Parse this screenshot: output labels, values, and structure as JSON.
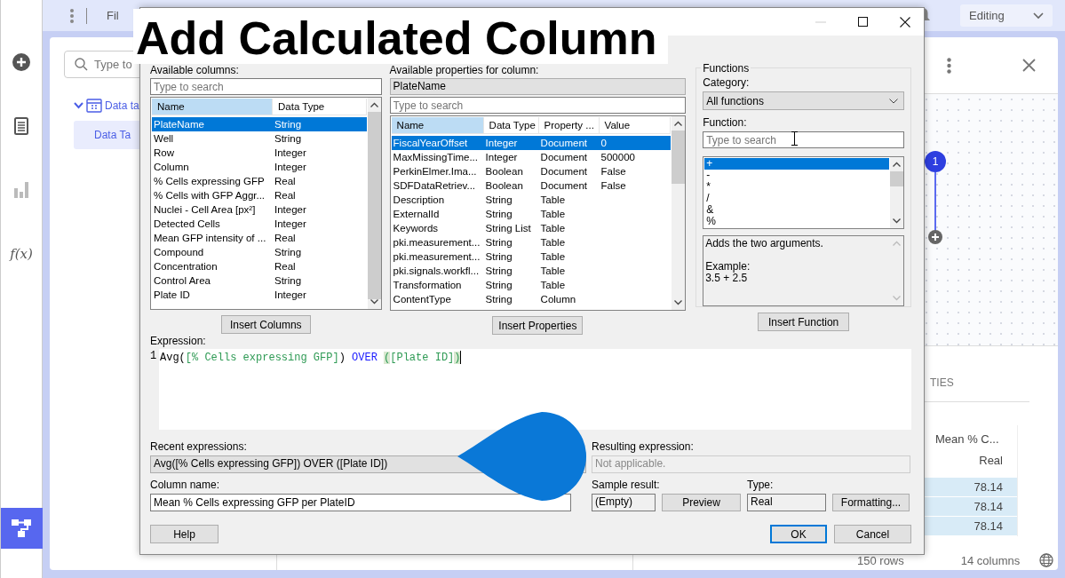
{
  "app": {
    "top_bar": {
      "menu_text": "Fil",
      "mode": "Editing"
    },
    "sidebar": [
      {
        "kind": "add",
        "selected": false,
        "disabled": false
      },
      {
        "kind": "table",
        "selected": false,
        "disabled": false
      },
      {
        "kind": "chart",
        "selected": false,
        "disabled": true
      },
      {
        "kind": "formula",
        "label": "f(x)",
        "selected": false,
        "disabled": false
      },
      {
        "kind": "flow",
        "selected": true,
        "disabled": false
      }
    ],
    "search": {
      "placeholder": "Type to"
    },
    "tree": [
      {
        "label": "Data ta",
        "expanded": true,
        "children": [
          {
            "label": "Data Ta",
            "selected": true
          }
        ]
      }
    ],
    "flow": {
      "step_number": "1"
    },
    "section_heading": "TIES",
    "table": {
      "column": "Mean % C...",
      "type": "Real",
      "values": [
        "78.14",
        "78.14",
        "78.14"
      ]
    },
    "status": {
      "rows": "150 rows",
      "columns": "14 columns"
    }
  },
  "caption": "Add Calculated Column",
  "dialog": {
    "available_columns": {
      "label": "Available columns:",
      "placeholder": "Type to search",
      "columns": [
        "Name",
        "Data Type"
      ],
      "rows": [
        {
          "name": "PlateName",
          "type": "String",
          "selected": true
        },
        {
          "name": "Well",
          "type": "String",
          "selected": false
        },
        {
          "name": "Row",
          "type": "Integer",
          "selected": false
        },
        {
          "name": "Column",
          "type": "Integer",
          "selected": false
        },
        {
          "name": "% Cells expressing GFP",
          "type": "Real",
          "selected": false
        },
        {
          "name": "% Cells with GFP Aggr...",
          "type": "Real",
          "selected": false
        },
        {
          "name": "Nuclei - Cell Area [px²]",
          "type": "Integer",
          "selected": false
        },
        {
          "name": "Detected Cells",
          "type": "Integer",
          "selected": false
        },
        {
          "name": "Mean GFP intensity of ...",
          "type": "Real",
          "selected": false
        },
        {
          "name": "Compound",
          "type": "String",
          "selected": false
        },
        {
          "name": "Concentration",
          "type": "Real",
          "selected": false
        },
        {
          "name": "Control Area",
          "type": "String",
          "selected": false
        },
        {
          "name": "Plate ID",
          "type": "Integer",
          "selected": false
        }
      ],
      "button": "Insert Columns"
    },
    "available_properties": {
      "label": "Available properties for column:",
      "column": "PlateName",
      "placeholder": "Type to search",
      "columns": [
        "Name",
        "Data Type",
        "Property ...",
        "Value"
      ],
      "rows": [
        {
          "name": "FiscalYearOffset",
          "type": "Integer",
          "property": "Document",
          "value": "0",
          "selected": true
        },
        {
          "name": "MaxMissingTime...",
          "type": "Integer",
          "property": "Document",
          "value": "500000",
          "selected": false
        },
        {
          "name": "PerkinElmer.Ima...",
          "type": "Boolean",
          "property": "Document",
          "value": "False",
          "selected": false
        },
        {
          "name": "SDFDataRetriev...",
          "type": "Boolean",
          "property": "Document",
          "value": "False",
          "selected": false
        },
        {
          "name": "Description",
          "type": "String",
          "property": "Table",
          "selected": false
        },
        {
          "name": "ExternalId",
          "type": "String",
          "property": "Table",
          "selected": false
        },
        {
          "name": "Keywords",
          "type": "String List",
          "property": "Table",
          "selected": false
        },
        {
          "name": "pki.measurement...",
          "type": "String",
          "property": "Table",
          "selected": false
        },
        {
          "name": "pki.measurement...",
          "type": "String",
          "property": "Table",
          "selected": false
        },
        {
          "name": "pki.signals.workfl...",
          "type": "String",
          "property": "Table",
          "selected": false
        },
        {
          "name": "Transformation",
          "type": "String",
          "property": "Table",
          "selected": false
        },
        {
          "name": "ContentType",
          "type": "String",
          "property": "Column",
          "selected": false
        }
      ],
      "button": "Insert Properties"
    },
    "functions": {
      "title": "Functions",
      "category_label": "Category:",
      "category": "All functions",
      "function_label": "Function:",
      "placeholder": "Type to search",
      "items": [
        {
          "label": "+",
          "selected": true
        },
        {
          "label": "-",
          "selected": false
        },
        {
          "label": "*",
          "selected": false
        },
        {
          "label": "/",
          "selected": false
        },
        {
          "label": "&",
          "selected": false
        },
        {
          "label": "%",
          "selected": false
        }
      ],
      "description": {
        "text": "Adds the two arguments.",
        "example_label": "Example:",
        "example": "3.5 + 2.5"
      },
      "button": "Insert Function"
    },
    "expression": {
      "label": "Expression:",
      "line_number": "1",
      "tokens": [
        {
          "text": "Avg(",
          "kind": "plain"
        },
        {
          "text": "[% Cells expressing GFP]",
          "kind": "column"
        },
        {
          "text": ") ",
          "kind": "plain"
        },
        {
          "text": "OVER ",
          "kind": "keyword"
        },
        {
          "text": "(",
          "kind": "match"
        },
        {
          "text": "[Plate ID]",
          "kind": "column"
        },
        {
          "text": ")",
          "kind": "match"
        }
      ]
    },
    "recent": {
      "label": "Recent expressions:",
      "value": "Avg([% Cells expressing GFP]) OVER ([Plate ID])"
    },
    "resulting": {
      "label": "Resulting expression:",
      "value": "Not applicable.",
      "disabled": true
    },
    "column_name": {
      "label": "Column name:",
      "value": "Mean % Cells expressing GFP per PlateID"
    },
    "sample": {
      "label": "Sample result:",
      "value": "(Empty)",
      "button": "Preview"
    },
    "type": {
      "label": "Type:",
      "value": "Real",
      "button": "Formatting..."
    },
    "help_button": "Help",
    "buttons": [
      {
        "label": "OK",
        "default": true
      },
      {
        "label": "Cancel",
        "default": false
      }
    ]
  }
}
